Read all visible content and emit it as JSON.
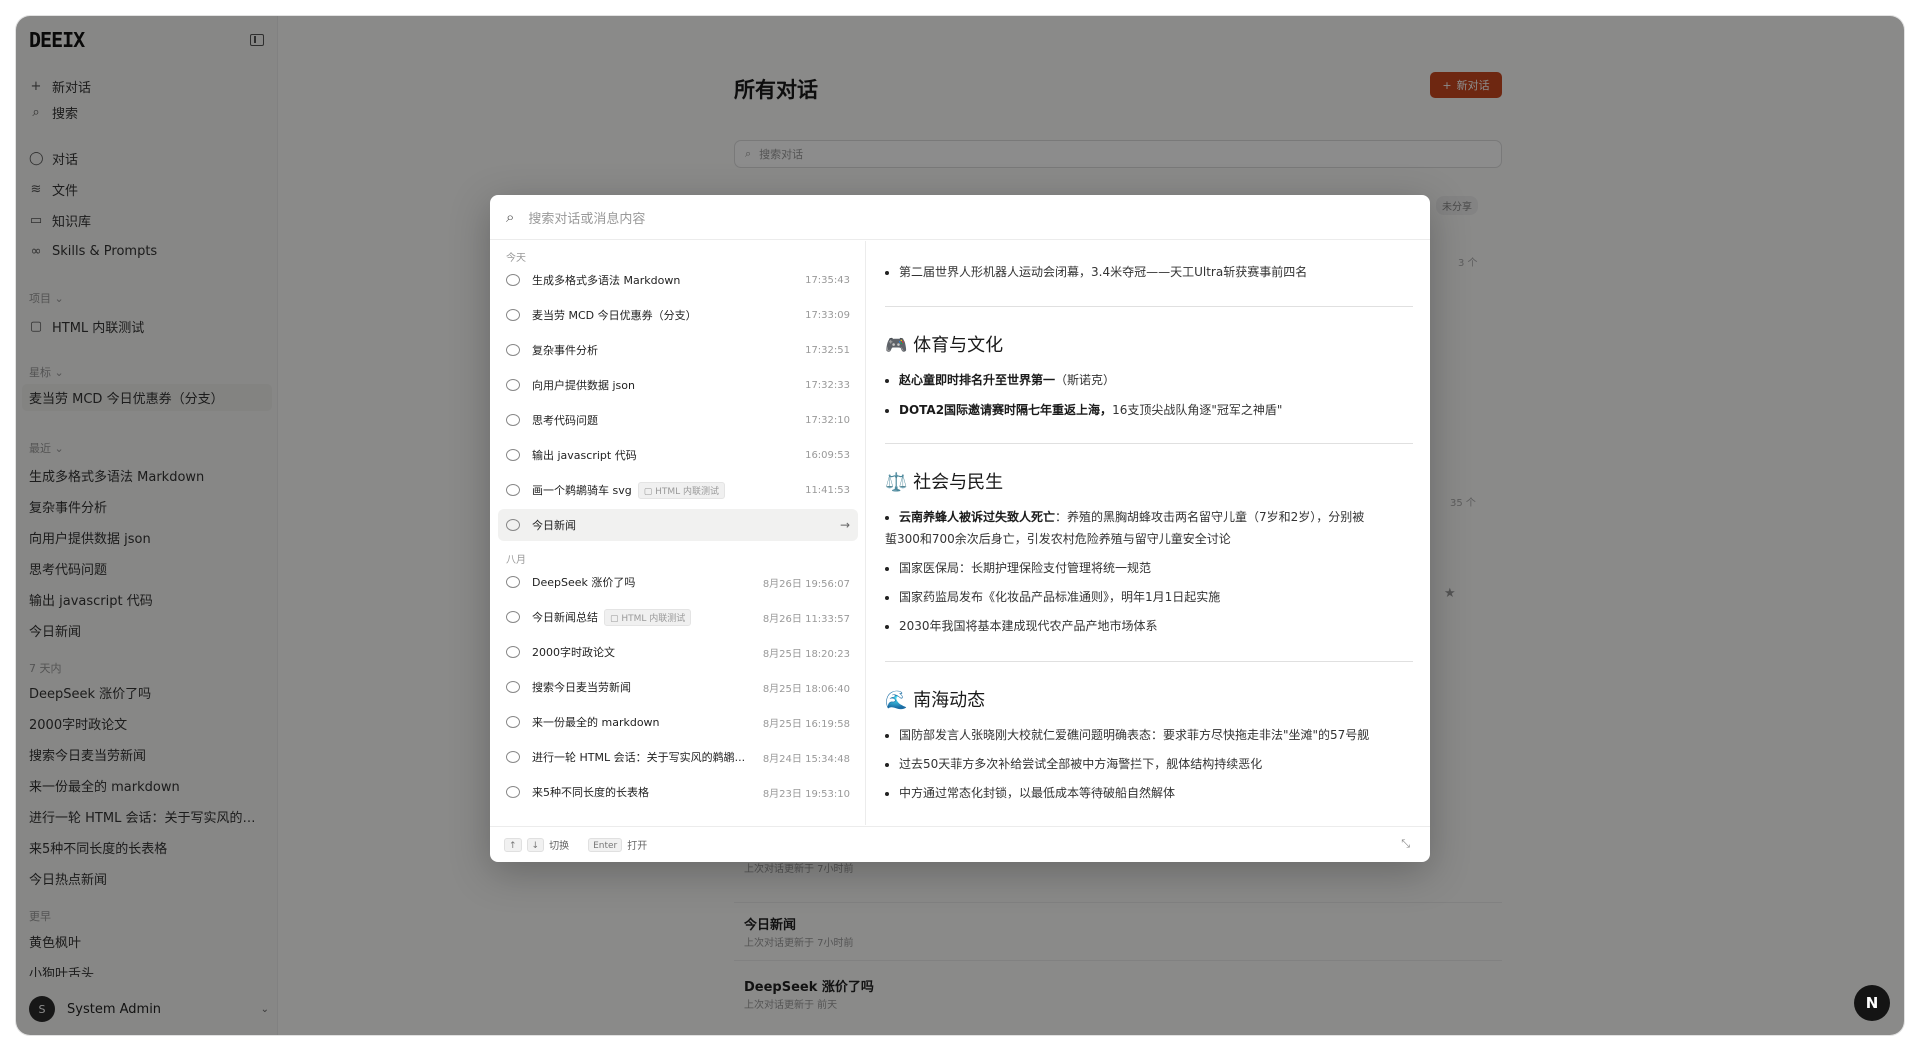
{
  "sidebar": {
    "logo": "DEEIX",
    "new_chat": "新对话",
    "search": "搜索",
    "nav": [
      "对话",
      "文件",
      "知识库",
      "Skills & Prompts"
    ],
    "projects_label": "项目",
    "project_item": "HTML 内联测试",
    "starred_label": "星标",
    "starred_item": "麦当劳 MCD 今日优惠券（分支）",
    "recent_label": "最近",
    "recent_items": [
      "生成多格式多语法 Markdown",
      "复杂事件分析",
      "向用户提供数据 json",
      "思考代码问题",
      "输出 javascript 代码",
      "今日新闻"
    ],
    "week_label": "7 天内",
    "week_items": [
      "DeepSeek 涨价了吗",
      "2000字时政论文",
      "搜索今日麦当劳新闻",
      "来一份最全的 markdown",
      "进行一轮 HTML 会话：关于写实风的鹈鹕",
      "来5种不同长度的长表格",
      "今日热点新闻"
    ],
    "older_label": "更早",
    "older_items": [
      "黄色枫叶",
      "小狗叶舌头"
    ],
    "user_initial": "S",
    "user_name": "System Admin"
  },
  "main": {
    "title": "所有对话",
    "new_chat_button": "新对话",
    "search_placeholder": "搜索对话",
    "unshared": "未分享",
    "count_top": "3 个",
    "count_mid": "35 个",
    "bg_convs": [
      {
        "title": "今日新闻",
        "sub": "上次对话更新于 7小时前"
      },
      {
        "title": "DeepSeek 涨价了吗",
        "sub": "上次对话更新于 前天"
      }
    ],
    "bg_sub_partial": "上次对话更新于 7小时前"
  },
  "modal": {
    "search_placeholder": "搜索对话或消息内容",
    "today_label": "今天",
    "today": [
      {
        "title": "生成多格式多语法 Markdown",
        "time": "17:35:43"
      },
      {
        "title": "麦当劳 MCD 今日优惠券（分支）",
        "time": "17:33:09"
      },
      {
        "title": "复杂事件分析",
        "time": "17:32:51"
      },
      {
        "title": "向用户提供数据 json",
        "time": "17:32:33"
      },
      {
        "title": "思考代码问题",
        "time": "17:32:10"
      },
      {
        "title": "输出 javascript 代码",
        "time": "16:09:53"
      },
      {
        "title": "画一个鹈鹕骑车 svg",
        "tag": "HTML 内联测试",
        "time": "11:41:53"
      },
      {
        "title": "今日新闻",
        "time": ""
      }
    ],
    "aug_label": "八月",
    "august": [
      {
        "title": "DeepSeek 涨价了吗",
        "time": "8月26日 19:56:07"
      },
      {
        "title": "今日新闻总结",
        "tag": "HTML 内联测试",
        "time": "8月26日 11:33:57"
      },
      {
        "title": "2000字时政论文",
        "time": "8月25日 18:20:23"
      },
      {
        "title": "搜索今日麦当劳新闻",
        "time": "8月25日 18:06:40"
      },
      {
        "title": "来一份最全的 markdown",
        "time": "8月25日 16:19:58"
      },
      {
        "title": "进行一轮 HTML 会话：关于写实风的鹈鹕...",
        "time": "8月24日 15:34:48"
      },
      {
        "title": "来5种不同长度的长表格",
        "time": "8月23日 19:53:10"
      }
    ],
    "preview": {
      "top_bullet": "第二届世界人形机器人运动会闭幕，3.4米夺冠——天工Ultra斩获赛事前四名",
      "sec1_icon": "🎮",
      "sec1_title": "体育与文化",
      "sec1_b1_bold": "赵心童即时排名升至世界第一",
      "sec1_b1_rest": "（斯诺克）",
      "sec1_b2_bold": "DOTA2国际邀请赛时隔七年重返上海，",
      "sec1_b2_rest": "16支顶尖战队角逐\"冠军之神盾\"",
      "sec2_icon": "⚖️",
      "sec2_title": "社会与民生",
      "sec2_b1_bold": "云南养蜂人被诉过失致人死亡",
      "sec2_b1_rest": "：养殖的黑胸胡蜂攻击两名留守儿童（7岁和2岁），分别被",
      "sec2_b1_cont": "蜇300和700余次后身亡，引发农村危险养殖与留守儿童安全讨论",
      "sec2_b2": "国家医保局：长期护理保险支付管理将统一规范",
      "sec2_b3": "国家药监局发布《化妆品产品标准通则》，明年1月1日起实施",
      "sec2_b4": "2030年我国将基本建成现代农产品产地市场体系",
      "sec3_icon": "🌊",
      "sec3_title": "南海动态",
      "sec3_b1": "国防部发言人张晓刚大校就仁爱礁问题明确表态：要求菲方尽快拖走非法\"坐滩\"的57号舰",
      "sec3_b2": "过去50天菲方多次补给尝试全部被中方海警拦下，舰体结构持续恶化",
      "sec3_b3": "中方通过常态化封锁，以最低成本等待破船自然解体"
    },
    "footer": {
      "up": "↑",
      "down": "↓",
      "switch": "切换",
      "enter": "Enter",
      "open": "打开"
    }
  },
  "floating_button": "N"
}
